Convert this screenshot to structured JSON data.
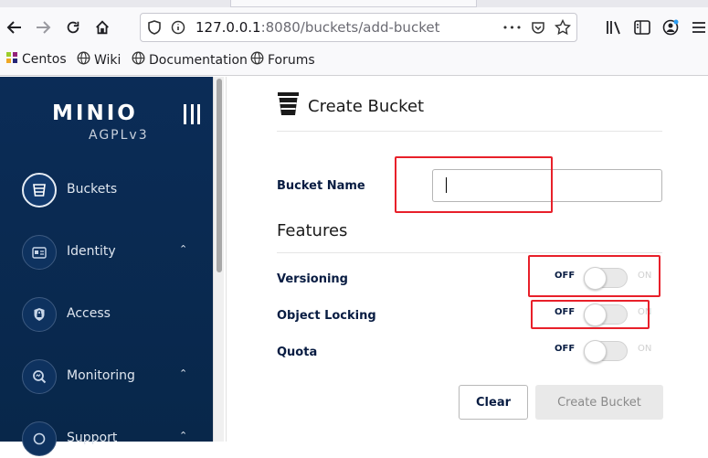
{
  "browser": {
    "url_host": "127.0.0.1",
    "url_rest": ":8080/buckets/add-bucket",
    "url_more": "•••",
    "bookmarks": [
      {
        "label": "Centos"
      },
      {
        "label": "Wiki"
      },
      {
        "label": "Documentation"
      },
      {
        "label": "Forums"
      }
    ]
  },
  "sidebar": {
    "logo": "MINIO",
    "license": "AGPLv3",
    "items": [
      {
        "label": "Buckets",
        "icon": "bucket-icon",
        "active": true
      },
      {
        "label": "Identity",
        "icon": "id-card-icon",
        "expandable": true
      },
      {
        "label": "Access",
        "icon": "lock-icon"
      },
      {
        "label": "Monitoring",
        "icon": "monitor-search-icon",
        "expandable": true
      },
      {
        "label": "Support",
        "icon": "support-icon",
        "expandable": true
      }
    ]
  },
  "form": {
    "title": "Create Bucket",
    "bucket_name_label": "Bucket Name",
    "bucket_name_value": "",
    "features_heading": "Features",
    "features": [
      {
        "label": "Versioning",
        "off": "OFF",
        "on": "ON",
        "enabled": false
      },
      {
        "label": "Object Locking",
        "off": "OFF",
        "on": "ON",
        "enabled": false
      },
      {
        "label": "Quota",
        "off": "OFF",
        "on": "ON",
        "enabled": false
      }
    ],
    "clear_label": "Clear",
    "create_label": "Create Bucket"
  },
  "colors": {
    "sidebar_bg": "#0b2c57",
    "highlight": "#e8202a",
    "label_text": "#081c42"
  }
}
